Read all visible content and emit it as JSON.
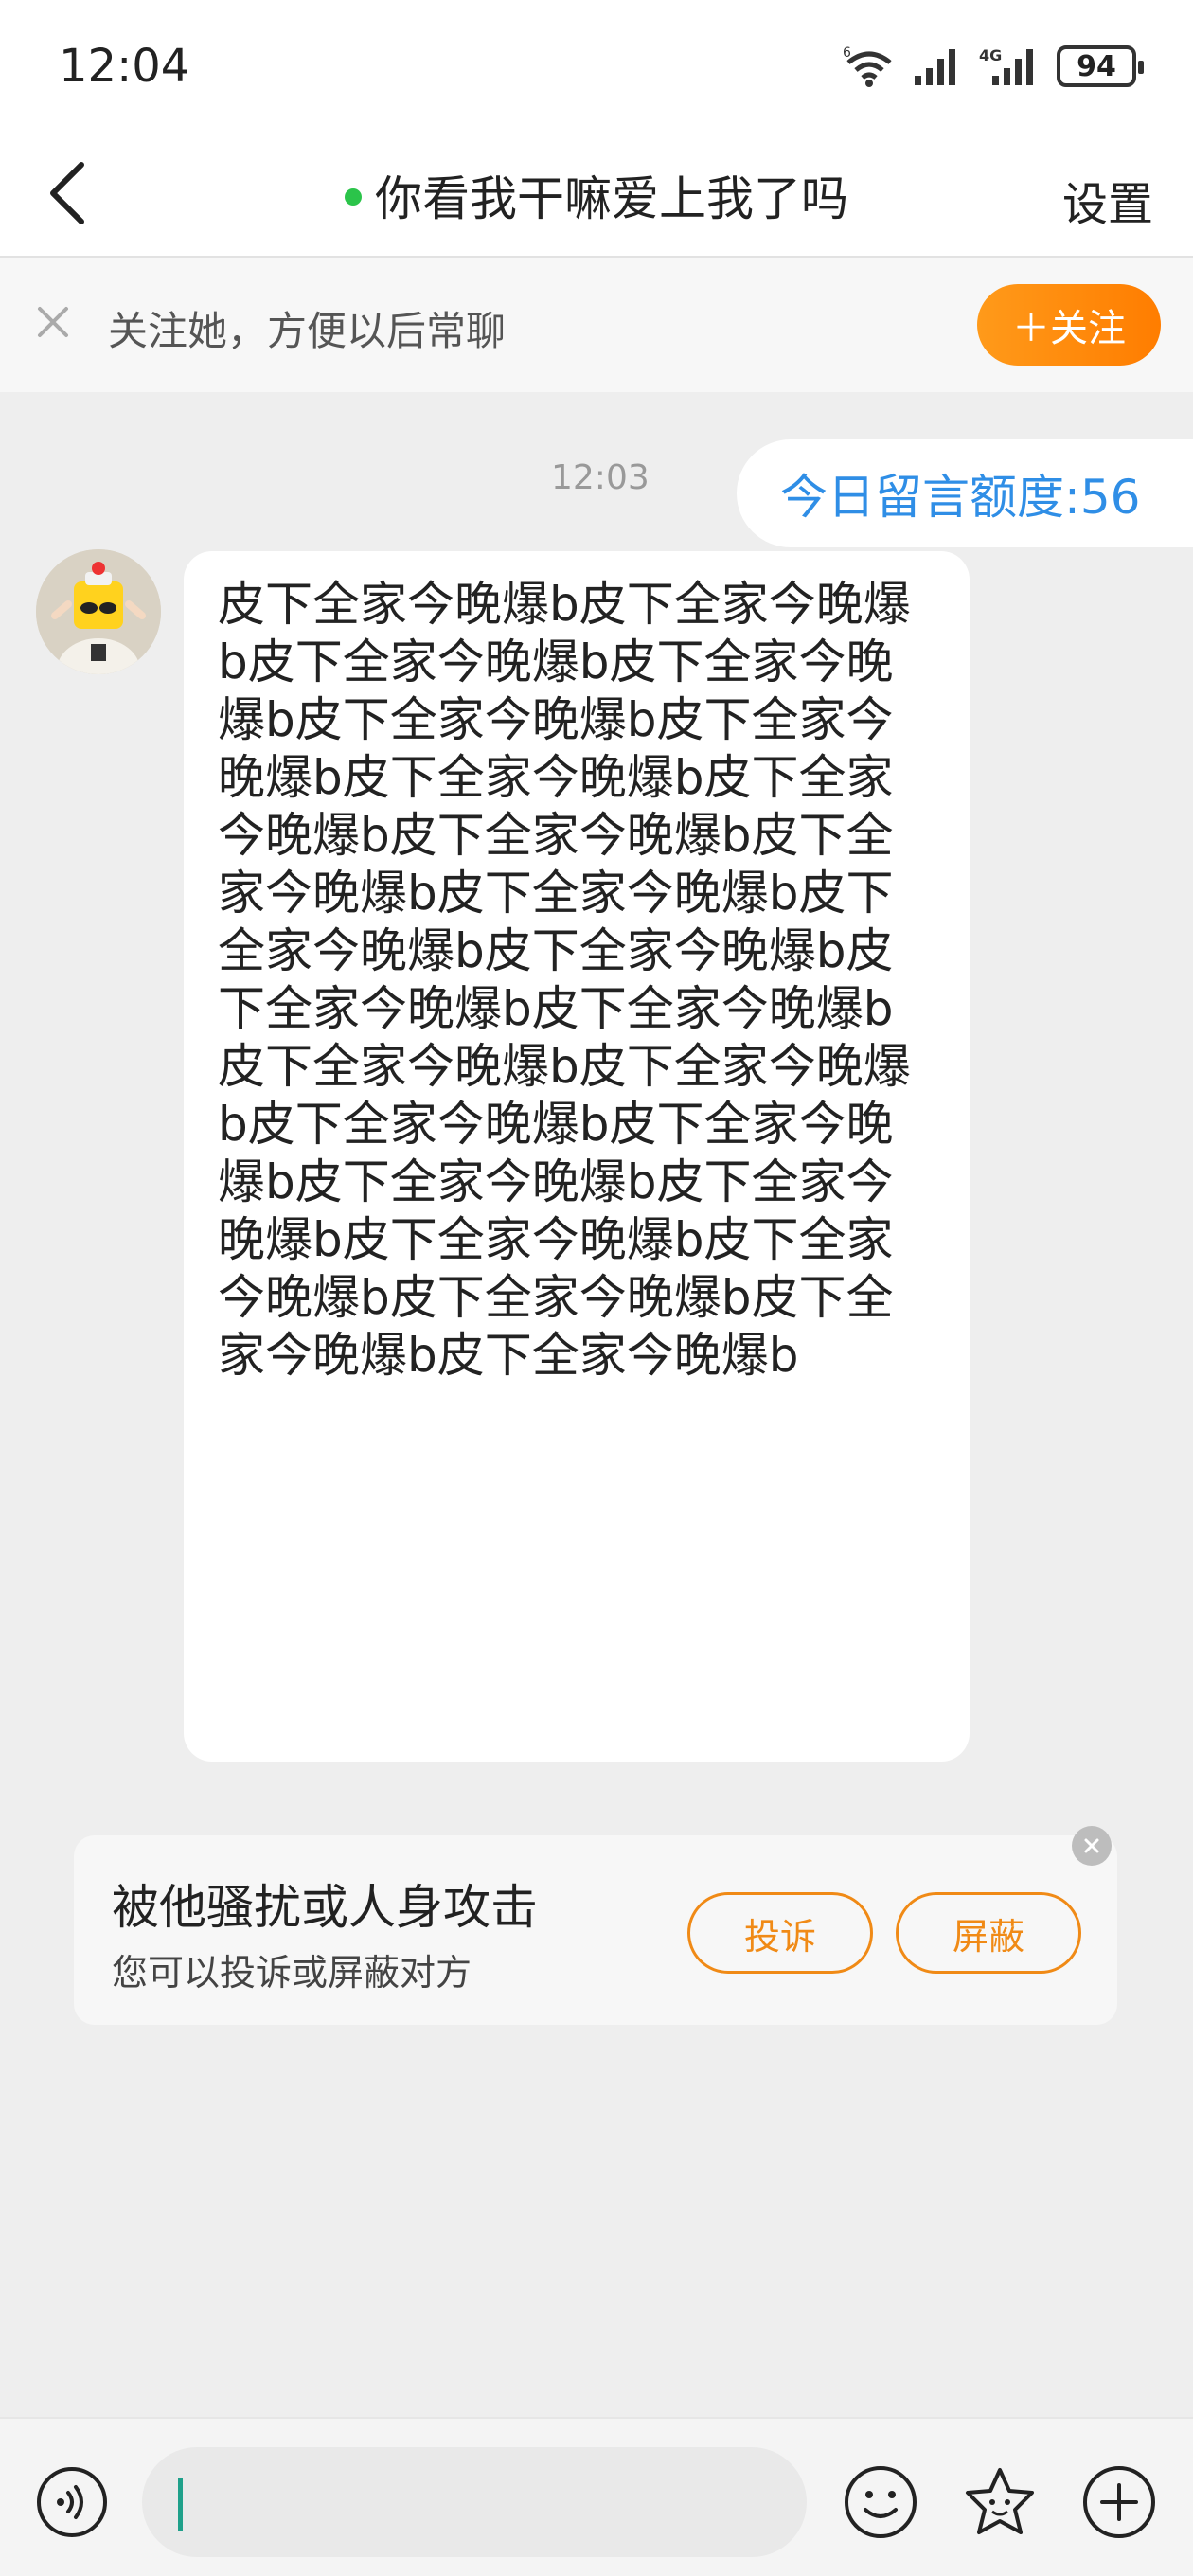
{
  "status_bar": {
    "time": "12:04",
    "network_label": "4G",
    "wifi_label": "6",
    "battery": "94"
  },
  "nav": {
    "title": "你看我干嘛爱上我了吗",
    "settings": "设置"
  },
  "follow_banner": {
    "text": "关注她，方便以后常聊",
    "button": "＋关注"
  },
  "chat": {
    "timestamp": "12:03",
    "quota": "今日留言额度:56",
    "message": "皮下全家今晚爆b皮下全家今晚爆b皮下全家今晚爆b皮下全家今晚爆b皮下全家今晚爆b皮下全家今晚爆b皮下全家今晚爆b皮下全家今晚爆b皮下全家今晚爆b皮下全家今晚爆b皮下全家今晚爆b皮下全家今晚爆b皮下全家今晚爆b皮下全家今晚爆b皮下全家今晚爆b皮下全家今晚爆b皮下全家今晚爆b皮下全家今晚爆b皮下全家今晚爆b皮下全家今晚爆b皮下全家今晚爆b皮下全家今晚爆b皮下全家今晚爆b皮下全家今晚爆b皮下全家今晚爆b皮下全家今晚爆b"
  },
  "harass_card": {
    "title": "被他骚扰或人身攻击",
    "subtitle": "您可以投诉或屏蔽对方",
    "report": "投诉",
    "block": "屏蔽"
  },
  "colors": {
    "accent": "#ff8a00",
    "link": "#2f8ee6",
    "online": "#2bc44a"
  }
}
